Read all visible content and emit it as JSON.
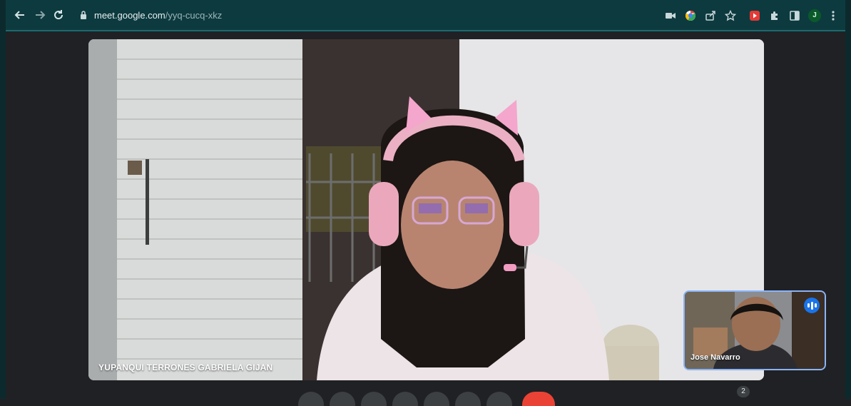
{
  "browser": {
    "url_host": "meet.google.com",
    "url_path": "/yyq-cucq-xkz",
    "profile_initial": "J"
  },
  "meeting": {
    "main_speaker_name": "YUPANQUI TERRONES GABRIELA GIJAN",
    "self_tile_name": "Jose Navarro",
    "participant_count": "2",
    "speaking_indicator": true
  },
  "colors": {
    "toolbar_bg": "#0d3a3f",
    "page_bg": "#202124",
    "tile_border": "#8ab4f8",
    "speaking_badge": "#1a73e8",
    "end_call": "#ea4335"
  },
  "controls": [
    "mic-button",
    "camera-button",
    "captions-button",
    "raise-hand-button",
    "present-button",
    "more-options-button",
    "end-call-button"
  ]
}
